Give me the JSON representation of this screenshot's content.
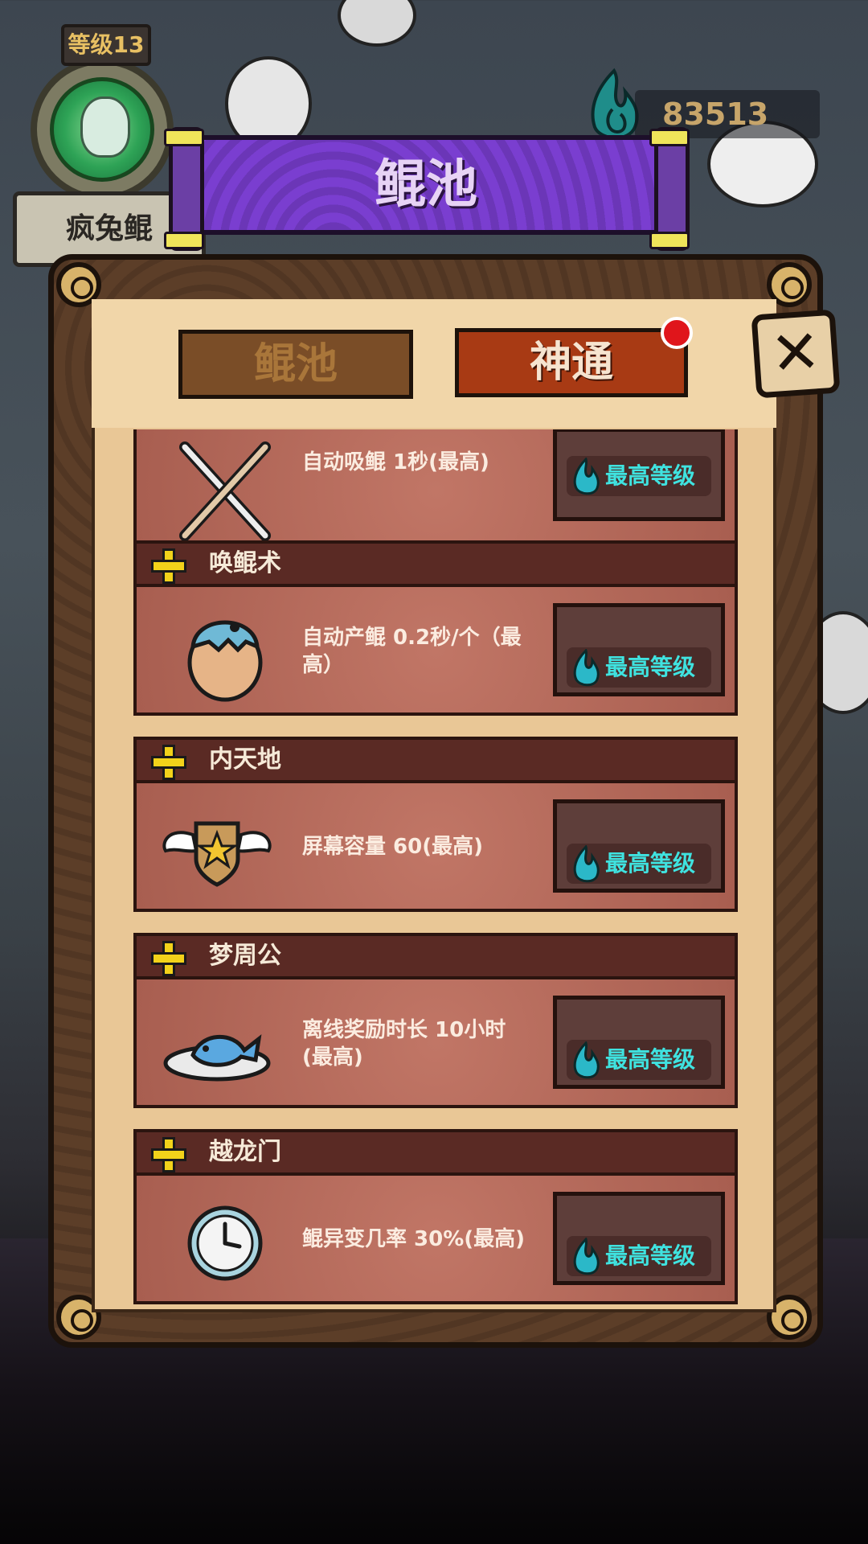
{
  "player": {
    "level_label": "等级13",
    "name": "疯兔鲲"
  },
  "currency": {
    "amount": "83513"
  },
  "title": "鲲池",
  "tabs": [
    {
      "label": "鲲池",
      "active": false
    },
    {
      "label": "神通",
      "active": true
    }
  ],
  "skills": [
    {
      "name": "",
      "desc": "自动吸鲲 1秒(最高)",
      "button": "最高等级",
      "icon": "fork-knife-icon"
    },
    {
      "name": "唤鲲术",
      "desc": "自动产鲲 0.2秒/个（最高）",
      "button": "最高等级",
      "icon": "egg-icon"
    },
    {
      "name": "内天地",
      "desc": "屏幕容量 60(最高)",
      "button": "最高等级",
      "icon": "winged-shield-icon"
    },
    {
      "name": "梦周公",
      "desc": "离线奖励时长 10小时(最高)",
      "button": "最高等级",
      "icon": "fish-plate-icon"
    },
    {
      "name": "越龙门",
      "desc": "鲲异变几率 30%(最高)",
      "button": "最高等级",
      "icon": "clock-icon"
    }
  ],
  "colors": {
    "accent_purple": "#7a3ed0",
    "active_tab": "#a83a14",
    "max_text": "#3fe3e0",
    "notify_dot": "#e0151b"
  }
}
